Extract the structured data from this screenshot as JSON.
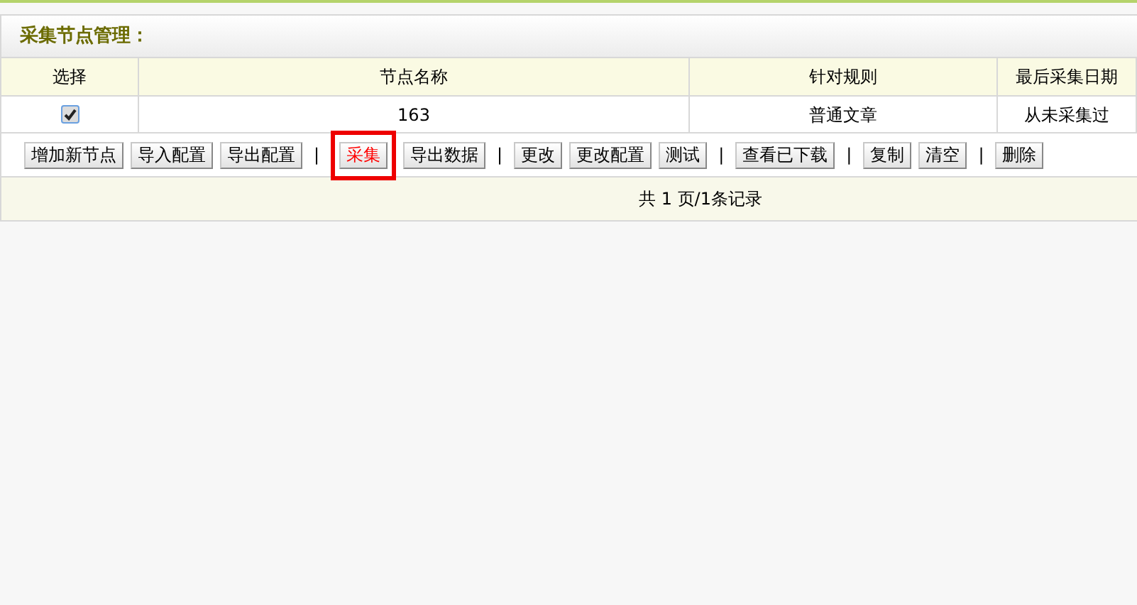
{
  "panel": {
    "title": "采集节点管理："
  },
  "table": {
    "columns": [
      "选择",
      "节点名称",
      "针对规则",
      "最后采集日期"
    ],
    "rows": [
      {
        "cells": [
          {
            "kind": "checkbox",
            "checked": true
          },
          {
            "kind": "text",
            "text": "163"
          },
          {
            "kind": "text",
            "text": "普通文章"
          },
          {
            "kind": "text",
            "text": "从未采集过"
          }
        ]
      }
    ]
  },
  "toolbar": [
    {
      "kind": "button",
      "label": "增加新节点",
      "highlighted": false
    },
    {
      "kind": "button",
      "label": "导入配置",
      "highlighted": false
    },
    {
      "kind": "button",
      "label": "导出配置",
      "highlighted": false
    },
    {
      "kind": "separator",
      "label": "|"
    },
    {
      "kind": "button",
      "label": "采集",
      "highlighted": true
    },
    {
      "kind": "button",
      "label": "导出数据",
      "highlighted": false
    },
    {
      "kind": "separator",
      "label": "|"
    },
    {
      "kind": "button",
      "label": "更改",
      "highlighted": false
    },
    {
      "kind": "button",
      "label": "更改配置",
      "highlighted": false
    },
    {
      "kind": "button",
      "label": "测试",
      "highlighted": false
    },
    {
      "kind": "separator",
      "label": "|"
    },
    {
      "kind": "button",
      "label": "查看已下载",
      "highlighted": false
    },
    {
      "kind": "separator",
      "label": "|"
    },
    {
      "kind": "button",
      "label": "复制",
      "highlighted": false
    },
    {
      "kind": "button",
      "label": "清空",
      "highlighted": false
    },
    {
      "kind": "separator",
      "label": "|"
    },
    {
      "kind": "button",
      "label": "删除",
      "highlighted": false
    }
  ],
  "pagination": "共 1 页/1条记录"
}
